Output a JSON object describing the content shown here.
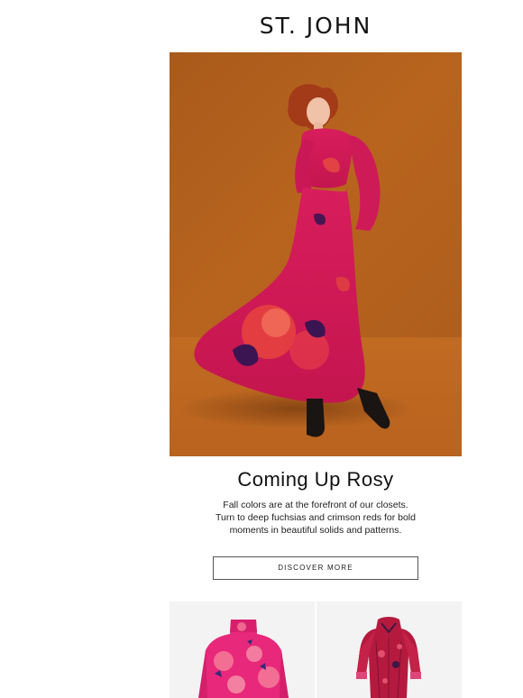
{
  "header": {
    "brand": "ST. JOHN"
  },
  "hero": {
    "image": "model-in-fuchsia-floral-maxi-dress"
  },
  "feature": {
    "headline": "Coming Up Rosy",
    "body_lines": [
      "Fall colors are at the forefront of our closets.",
      "Turn to deep fuchsias and crimson reds for bold",
      "moments in beautiful solids and patterns."
    ],
    "cta_label": "DISCOVER MORE"
  },
  "products": [
    {
      "image": "pink-floral-turtleneck-top"
    },
    {
      "image": "crimson-printed-dress"
    }
  ],
  "colors": {
    "hero_bg": "#b4611d",
    "fuchsia": "#d41c5c",
    "crimson": "#9a1236"
  }
}
